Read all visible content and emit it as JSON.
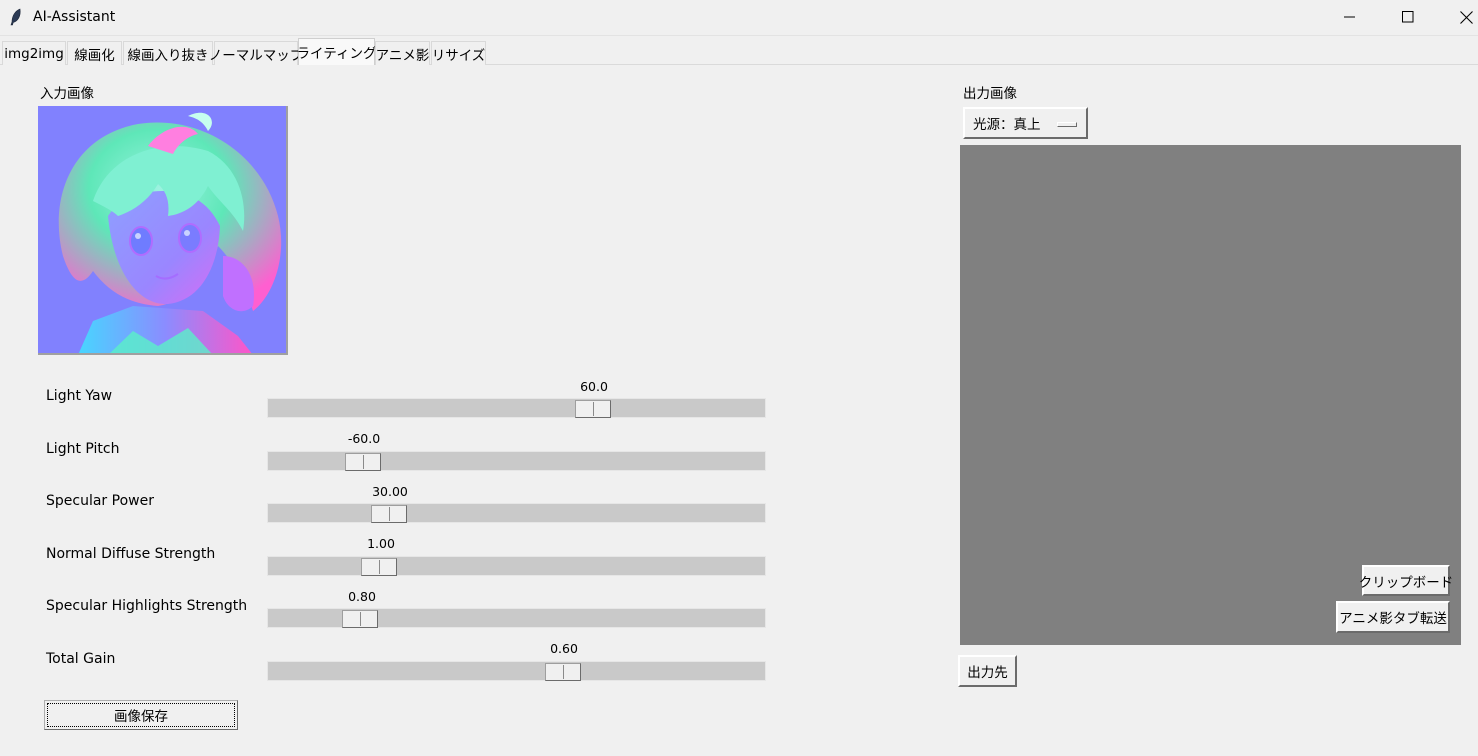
{
  "window": {
    "title": "AI-Assistant",
    "icons": [
      "feather-icon",
      "minimize-icon",
      "maximize-icon",
      "close-icon"
    ]
  },
  "tabs": [
    {
      "label": "img2img",
      "active": false
    },
    {
      "label": "線画化",
      "active": false
    },
    {
      "label": "線画入り抜き",
      "active": false
    },
    {
      "label": "ノーマルマップ",
      "active": false
    },
    {
      "label": "ライティング",
      "active": true
    },
    {
      "label": "アニメ影",
      "active": false
    },
    {
      "label": "リサイズ",
      "active": false
    }
  ],
  "input_panel": {
    "label": "入力画像"
  },
  "sliders": [
    {
      "label": "Light Yaw",
      "value": "60.0",
      "numeric": 60.0,
      "min": -180,
      "max": 180
    },
    {
      "label": "Light Pitch",
      "value": "-60.0",
      "numeric": -60.0,
      "min": -90,
      "max": 90
    },
    {
      "label": "Specular Power",
      "value": "30.00",
      "numeric": 30.0,
      "min": 0,
      "max": 200
    },
    {
      "label": "Normal Diffuse Strength",
      "value": "1.00",
      "numeric": 1.0,
      "min": 0,
      "max": 5
    },
    {
      "label": "Specular Highlights Strength",
      "value": "0.80",
      "numeric": 0.8,
      "min": 0,
      "max": 5
    },
    {
      "label": "Total Gain",
      "value": "0.60",
      "numeric": 0.6,
      "min": 0,
      "max": 1
    }
  ],
  "save_button": {
    "label": "画像保存"
  },
  "output_panel": {
    "label": "出力画像",
    "light_source_option": "光源：真上",
    "clipboard_button": "クリップボード",
    "send_to_anime_shadow_button": "アニメ影タブ転送",
    "output_dir_button": "出力先"
  },
  "colors": {
    "background": "#f0f0f0",
    "canvas": "#808080",
    "trough": "#c9c9c9"
  }
}
